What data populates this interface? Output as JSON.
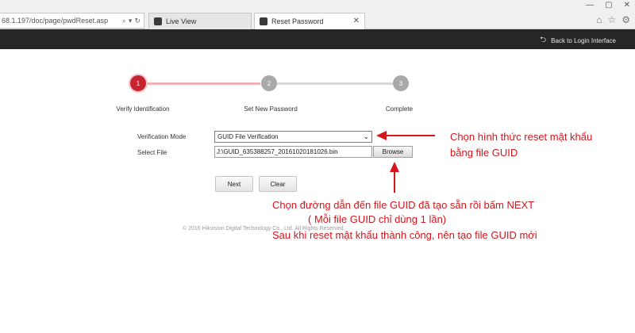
{
  "browser": {
    "address": "68.1.197/doc/page/pwdReset.asp",
    "tabs": [
      {
        "label": "Live View"
      },
      {
        "label": "Reset Password"
      }
    ]
  },
  "header": {
    "back_label": "Back to Login Interface"
  },
  "stepper": {
    "steps": [
      {
        "number": "1",
        "label": "Verify Identification"
      },
      {
        "number": "2",
        "label": "Set New Password"
      },
      {
        "number": "3",
        "label": "Complete"
      }
    ],
    "current_step": 1
  },
  "form": {
    "mode_label": "Verification Mode",
    "mode_value": "GUID File Verification",
    "file_label": "Select File",
    "file_value": "J:\\GUID_635388257_20161020181026.bin",
    "browse_label": "Browse",
    "next_label": "Next",
    "clear_label": "Clear"
  },
  "footer": {
    "copyright": "© 2016 Hikvision Digital Technology Co., Ltd. All Rights Reserved."
  },
  "annotations": {
    "mode_note_line1": "Chọn hình thức reset mật khẩu",
    "mode_note_line2": "bằng file GUID",
    "file_note_line1": "Chọn đường dẫn đến file GUID đã tạo sẵn rồi bấm NEXT",
    "file_note_line2": "( Mỗi file GUID chỉ dùng 1 lần)",
    "file_note_line3": "Sau khi reset mật khẩu thành công, nên tạo file GUID mới"
  },
  "colors": {
    "accent": "#c6252f",
    "annotation": "#d4161d",
    "header_bg": "#262626"
  },
  "icons": {
    "tabs": [
      "page-icon",
      "page-icon"
    ],
    "nav": [
      "home-icon",
      "star-icon",
      "gear-icon"
    ],
    "back": "arrow-left-icon"
  }
}
